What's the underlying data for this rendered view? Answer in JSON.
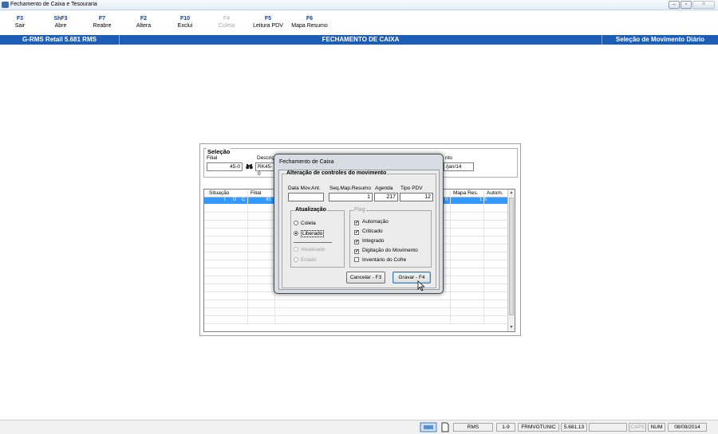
{
  "window": {
    "title": "Fechamento de Caixa e Tesouraria",
    "min": "–",
    "max": "▫",
    "close": "✕"
  },
  "toolbar": {
    "keys": [
      {
        "key": "F3",
        "label": "Sair",
        "enabled": true
      },
      {
        "key": "ShF3",
        "label": "Abre",
        "enabled": true
      },
      {
        "key": "F7",
        "label": "Reabre",
        "enabled": true
      },
      {
        "key": "F2",
        "label": "Altera",
        "enabled": true
      },
      {
        "key": "F10",
        "label": "Exclui",
        "enabled": true
      },
      {
        "key": "F4",
        "label": "Coleta",
        "enabled": false
      },
      {
        "key": "F5",
        "label": "Leitura PDV",
        "enabled": true
      },
      {
        "key": "F6",
        "label": "Mapa Resumo",
        "enabled": true
      }
    ]
  },
  "header": {
    "app": "G-RMS Retail 5.681 RMS",
    "screen": "FECHAMENTO DE CAIXA",
    "context": "Seleção de Movimento Diário"
  },
  "selecao": {
    "title": "Seleção",
    "filial_label": "Filial",
    "filial_value": "45-0",
    "descricao_label": "Descriç",
    "descricao_value": "RK45-0",
    "movimento_label": "nto",
    "movimento_value": "/jan/14"
  },
  "grid": {
    "headers": [
      "Situação",
      "Filial",
      "Mapa Res.",
      "Autom."
    ],
    "row": {
      "s1": "I",
      "s2": "D",
      "s3": "C",
      "filial": "45",
      "mid": "0",
      "mapa": "1",
      "autom": "S"
    },
    "scroll_up": "▲",
    "scroll_down": "▼"
  },
  "dialog": {
    "title": "Fechamento de Caixa",
    "group_title": "Alteração de controles do movimento",
    "fields": {
      "data_mov_label": "Data Mov.Ant.",
      "data_mov_value": "",
      "seq_label": "Seq.Map.Resumo",
      "seq_value": "1",
      "agenda_label": "Agenda",
      "agenda_value": "217",
      "tipo_label": "Tipo PDV",
      "tipo_value": "12"
    },
    "atualizacao": {
      "title": "Atualização",
      "options": [
        {
          "label": "Coleta",
          "checked": false,
          "enabled": true
        },
        {
          "label": "Liberado",
          "checked": true,
          "enabled": true
        },
        {
          "label": "Atualizado",
          "checked": false,
          "enabled": false
        },
        {
          "label": "Errado",
          "checked": false,
          "enabled": false
        }
      ]
    },
    "flags": {
      "title": "Flag",
      "items": [
        {
          "label": "Automação",
          "checked": true
        },
        {
          "label": "Criticado",
          "checked": true
        },
        {
          "label": "Integrado",
          "checked": true
        },
        {
          "label": "Digitação do Movimento",
          "checked": true
        },
        {
          "label": "Inventário do Cofre",
          "checked": false
        }
      ]
    },
    "buttons": {
      "cancel": "Cancelar - F3",
      "save": "Gravar - F4"
    }
  },
  "statusbar": {
    "system": "RMS",
    "page": "1-9",
    "form": "FRMVGTUNIC",
    "version": "5.681.13",
    "caps": "CAPS",
    "num": "NUM",
    "date": "08/09/2014"
  }
}
